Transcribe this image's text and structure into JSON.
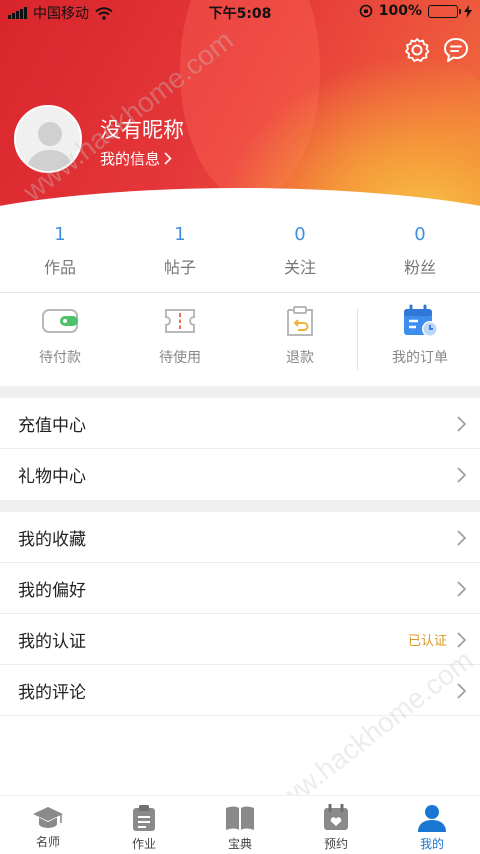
{
  "status_bar": {
    "carrier": "中国移动",
    "time": "下午5:08",
    "battery_percent": "100%"
  },
  "profile": {
    "nickname": "没有昵称",
    "my_info_link": "我的信息",
    "header_icons": [
      "settings-icon",
      "message-icon"
    ]
  },
  "stats": [
    {
      "value": "1",
      "label": "作品"
    },
    {
      "value": "1",
      "label": "帖子"
    },
    {
      "value": "0",
      "label": "关注"
    },
    {
      "value": "0",
      "label": "粉丝"
    }
  ],
  "orders": [
    {
      "label": "待付款",
      "icon": "wallet-icon"
    },
    {
      "label": "待使用",
      "icon": "ticket-icon"
    },
    {
      "label": "退款",
      "icon": "refund-icon"
    },
    {
      "label": "我的订单",
      "icon": "calendar-order-icon"
    }
  ],
  "menu_group_1": [
    {
      "label": "充值中心"
    },
    {
      "label": "礼物中心"
    }
  ],
  "menu_group_2": [
    {
      "label": "我的收藏",
      "badge": ""
    },
    {
      "label": "我的偏好",
      "badge": ""
    },
    {
      "label": "我的认证",
      "badge": "已认证"
    },
    {
      "label": "我的评论",
      "badge": ""
    }
  ],
  "tabs": [
    {
      "label": "名师",
      "icon": "graduation-cap-icon",
      "active": false
    },
    {
      "label": "作业",
      "icon": "clipboard-icon",
      "active": false
    },
    {
      "label": "宝典",
      "icon": "book-icon",
      "active": false
    },
    {
      "label": "预约",
      "icon": "calendar-check-icon",
      "active": false
    },
    {
      "label": "我的",
      "icon": "user-icon",
      "active": true
    }
  ],
  "colors": {
    "brand_red": "#e0302f",
    "stat_blue": "#3f8fe0",
    "active_tab_blue": "#1976d2",
    "verified_gold": "#d99a24"
  },
  "watermark": "www.hackhome.com"
}
